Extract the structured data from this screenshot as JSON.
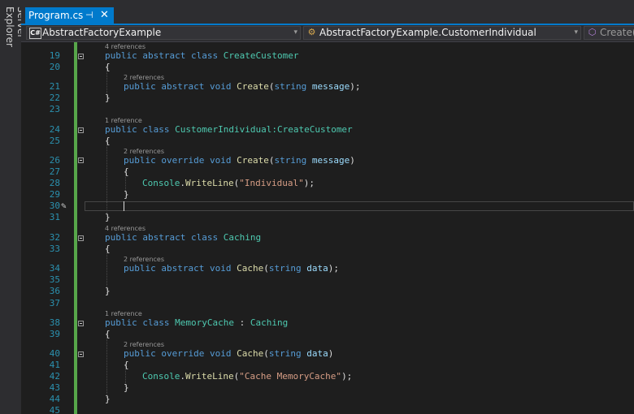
{
  "sidebar": {
    "server_explorer": "Server Explorer"
  },
  "tab": {
    "title": "Program.cs",
    "pin": "⊣",
    "close": "✕"
  },
  "navbar": {
    "project": "AbstractFactoryExample",
    "type": "AbstractFactoryExample.CustomerIndividual",
    "member": "Create(st",
    "project_icon": "C#",
    "type_icon": "⚙",
    "member_icon": "⬡",
    "dropdown": "▾"
  },
  "editor": {
    "line_numbers": {
      "l19": "19",
      "l20": "20",
      "l21": "21",
      "l22": "22",
      "l23": "23",
      "l24": "24",
      "l25": "25",
      "l26": "26",
      "l27": "27",
      "l28": "28",
      "l29": "29",
      "l30": "30",
      "l31": "31",
      "l32": "32",
      "l33": "33",
      "l34": "34",
      "l35": "35",
      "l36": "36",
      "l37": "37",
      "l38": "38",
      "l39": "39",
      "l40": "40",
      "l41": "41",
      "l42": "42",
      "l43": "43",
      "l44": "44",
      "l45": "45"
    },
    "codelens": {
      "a": "4 references",
      "b": "2 references",
      "c": "1 reference",
      "d": "2 references",
      "e": "4 references",
      "f": "2 references",
      "g": "1 reference",
      "h": "2 references"
    },
    "tokens": {
      "public": "public",
      "abstract": "abstract",
      "class": "class",
      "void": "void",
      "override": "override",
      "string": "string",
      "createcustomer": "CreateCustomer",
      "customerindividual": "CustomerIndividual",
      "colon_createcustomer": ":CreateCustomer",
      "create": "Create",
      "caching": "Caching",
      "cache": "Cache",
      "memorycache": "MemoryCache",
      "colon": " : ",
      "message": "message",
      "data": "data",
      "console": "Console",
      "writeline": "WriteLine",
      "str_individual": "\"Individual\"",
      "str_cache": "\"Cache MemoryCache\"",
      "open_brace": "{",
      "close_brace": "}",
      "paren_open": "(",
      "paren_close": ")",
      "paren_close_semi": ");",
      "dot": ".",
      "space": " "
    }
  }
}
